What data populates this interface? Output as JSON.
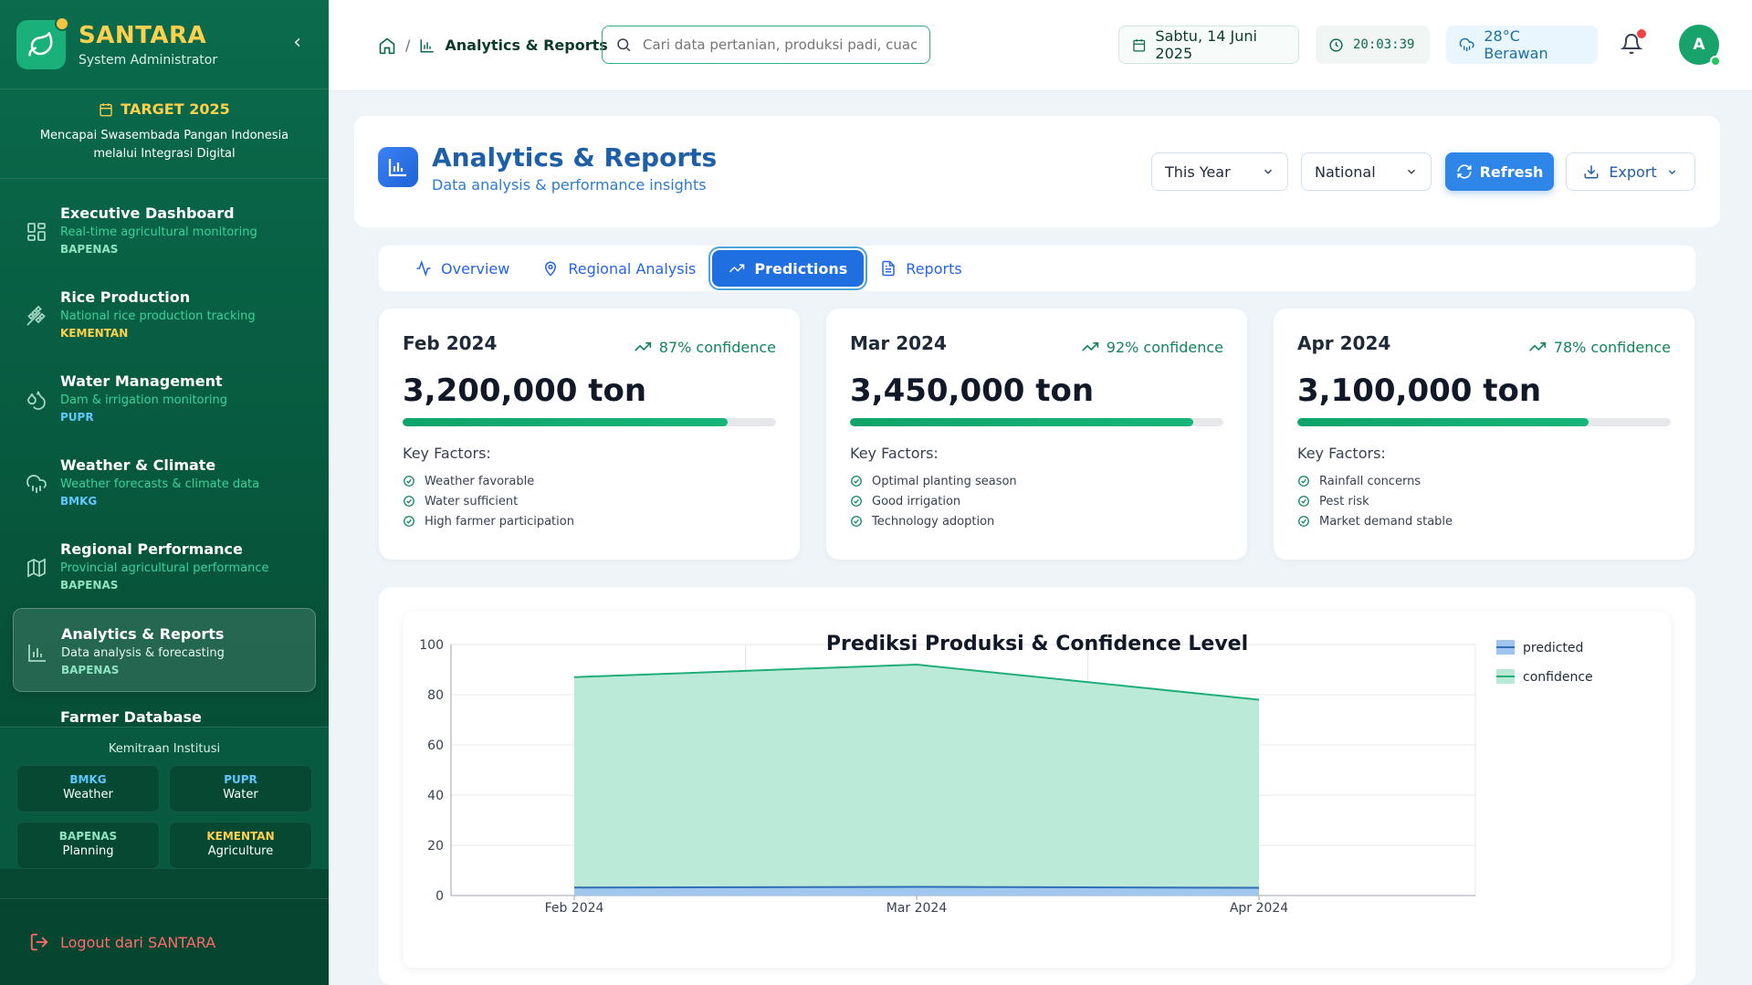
{
  "brand": {
    "name": "SANTARA",
    "role": "System Administrator"
  },
  "target": {
    "title": "TARGET 2025",
    "desc": "Mencapai Swasembada Pangan Indonesia melalui Integrasi Digital"
  },
  "nav": [
    {
      "title": "Executive Dashboard",
      "sub": "Real-time agricultural monitoring",
      "tag": "BAPENAS",
      "icon": "dashboard-icon"
    },
    {
      "title": "Rice Production",
      "sub": "National rice production tracking",
      "tag": "KEMENTAN",
      "icon": "wheat-icon"
    },
    {
      "title": "Water Management",
      "sub": "Dam & irrigation monitoring",
      "tag": "PUPR",
      "icon": "water-drop-icon"
    },
    {
      "title": "Weather & Climate",
      "sub": "Weather forecasts & climate data",
      "tag": "BMKG",
      "icon": "cloud-rain-icon"
    },
    {
      "title": "Regional Performance",
      "sub": "Provincial agricultural performance",
      "tag": "BAPENAS",
      "icon": "map-icon"
    },
    {
      "title": "Analytics & Reports",
      "sub": "Data analysis & forecasting",
      "tag": "BAPENAS",
      "icon": "bar-chart-icon"
    },
    {
      "title": "Farmer Database",
      "sub": "",
      "tag": "",
      "icon": "users-icon"
    }
  ],
  "partners": {
    "title": "Kemitraan Institusi",
    "items": [
      {
        "name": "BMKG",
        "desc": "Weather",
        "color": "#5ec8ff"
      },
      {
        "name": "PUPR",
        "desc": "Water",
        "color": "#5ec8ff"
      },
      {
        "name": "BAPENAS",
        "desc": "Planning",
        "color": "#8fe3c0"
      },
      {
        "name": "KEMENTAN",
        "desc": "Agriculture",
        "color": "#ffd04d"
      }
    ]
  },
  "logout": "Logout dari SANTARA",
  "header": {
    "breadcrumb_sep": "/",
    "breadcrumb_current": "Analytics & Reports",
    "search_placeholder": "Cari data pertanian, produksi padi, cuaca...",
    "date": "Sabtu, 14 Juni 2025",
    "time": "20:03:39",
    "weather": "28°C Berawan",
    "avatar": "A"
  },
  "page": {
    "title": "Analytics & Reports",
    "subtitle": "Data analysis & performance insights",
    "period": "This Year",
    "scope": "National",
    "refresh": "Refresh",
    "export": "Export"
  },
  "tabs": [
    {
      "label": "Overview",
      "icon": "activity-icon"
    },
    {
      "label": "Regional Analysis",
      "icon": "map-pin-icon"
    },
    {
      "label": "Predictions",
      "icon": "trend-up-icon"
    },
    {
      "label": "Reports",
      "icon": "document-icon"
    }
  ],
  "predictions": [
    {
      "month": "Feb 2024",
      "confidence": "87% confidence",
      "conf_value": 87,
      "value": "3,200,000 ton",
      "key_label": "Key Factors:",
      "factors": [
        "Weather favorable",
        "Water sufficient",
        "High farmer participation"
      ]
    },
    {
      "month": "Mar 2024",
      "confidence": "92% confidence",
      "conf_value": 92,
      "value": "3,450,000 ton",
      "key_label": "Key Factors:",
      "factors": [
        "Optimal planting season",
        "Good irrigation",
        "Technology adoption"
      ]
    },
    {
      "month": "Apr 2024",
      "confidence": "78% confidence",
      "conf_value": 78,
      "value": "3,100,000 ton",
      "key_label": "Key Factors:",
      "factors": [
        "Rainfall concerns",
        "Pest risk",
        "Market demand stable"
      ]
    }
  ],
  "chart_data": {
    "type": "area",
    "title": "Prediksi Produksi & Confidence Level",
    "categories": [
      "Feb 2024",
      "Mar 2024",
      "Apr 2024"
    ],
    "ylim": [
      0,
      100
    ],
    "yticks": [
      0,
      20,
      40,
      60,
      80,
      100
    ],
    "grid": true,
    "legend_position": "top-right",
    "series": [
      {
        "name": "predicted",
        "values": [
          3.2,
          3.45,
          3.1
        ],
        "stroke": "#2f6fb5",
        "fill": "#9ec5ef"
      },
      {
        "name": "confidence",
        "values": [
          87,
          92,
          78
        ],
        "stroke": "#1fae78",
        "fill": "#b7e9d6"
      }
    ]
  }
}
